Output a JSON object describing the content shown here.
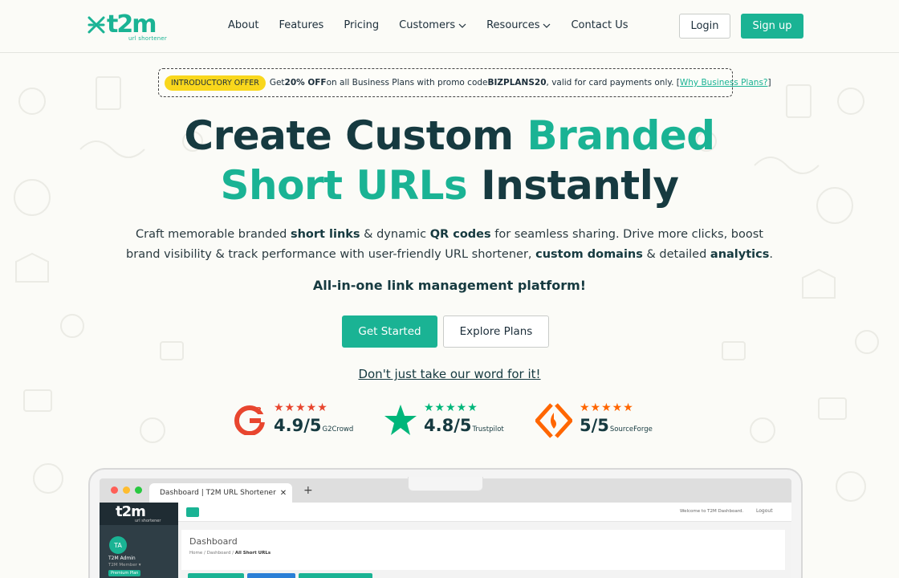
{
  "brand": {
    "logo_text": "t2m",
    "logo_sub": "url shortener",
    "accent": "#1ab394",
    "dark": "#163a40"
  },
  "nav": {
    "about": "About",
    "features": "Features",
    "pricing": "Pricing",
    "customers": "Customers",
    "resources": "Resources",
    "contact": "Contact Us"
  },
  "auth": {
    "login": "Login",
    "signup": "Sign up"
  },
  "promo": {
    "badge": "INTRODUCTORY OFFER",
    "text1": "Get ",
    "discount": "20% OFF",
    "text2": " on all Business Plans with promo code ",
    "code": "BIZPLANS20",
    "text3": ", valid for card payments only. [",
    "link": "Why Business Plans?",
    "text4": "]"
  },
  "hero": {
    "line1_a": "Create Custom ",
    "line1_b": "Branded",
    "line2_a": "Short URLs",
    "line2_b": " Instantly",
    "sub_1": "Craft memorable branded ",
    "sub_b1": "short links",
    "sub_2": " & dynamic ",
    "sub_b2": "QR codes",
    "sub_3": " for seamless sharing. Drive more clicks, boost",
    "sub_4": "brand visibility & track performance with user-friendly URL shortener, ",
    "sub_b3": "custom domains",
    "sub_5": " & detailed ",
    "sub_b4": "analytics",
    "sub_6": ".",
    "tagline": "All-in-one link management platform!",
    "get_started": "Get Started",
    "explore_plans": "Explore Plans",
    "word": "Don't just take our word for it!"
  },
  "ratings": [
    {
      "score": "4.9/5",
      "source": "G2Crowd",
      "stars": 5,
      "icon": "g2-icon",
      "star_color": "#e8462f"
    },
    {
      "score": "4.8/5",
      "source": "Trustpilot",
      "stars": 5,
      "icon": "trustpilot-star-icon",
      "star_color": "#00b67a"
    },
    {
      "score": "5/5",
      "source": "SourceForge",
      "stars": 5,
      "icon": "sourceforge-icon",
      "star_color": "#ff6600"
    }
  ],
  "mockup": {
    "tab_title": "Dashboard | T2M URL Shortener",
    "avatar": "TA",
    "user_name": "T2M Admin",
    "user_role": "T2M Member ▾",
    "plan": "Premium Plan",
    "welcome": "Welcome to T2M Dashboard.",
    "logout": "Logout",
    "page_title": "Dashboard",
    "crumb_home": "Home",
    "crumb_dash": "Dashboard",
    "crumb_current": "All Short URLs",
    "sb_logo": "t2m",
    "sb_logo_sub": "url shortener"
  }
}
